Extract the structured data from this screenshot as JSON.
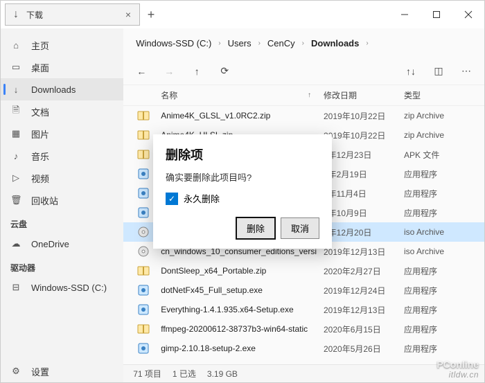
{
  "tab": {
    "label": "下载"
  },
  "sidebar": {
    "items": [
      {
        "label": "主页"
      },
      {
        "label": "桌面"
      },
      {
        "label": "Downloads"
      },
      {
        "label": "文档"
      },
      {
        "label": "图片"
      },
      {
        "label": "音乐"
      },
      {
        "label": "视频"
      },
      {
        "label": "回收站"
      }
    ],
    "cloud_header": "云盘",
    "cloud_items": [
      {
        "label": "OneDrive"
      }
    ],
    "drive_header": "驱动器",
    "drive_items": [
      {
        "label": "Windows-SSD (C:)"
      }
    ],
    "settings_label": "设置"
  },
  "breadcrumb": {
    "segs": [
      "Windows-SSD (C:)",
      "Users",
      "CenCy",
      "Downloads"
    ]
  },
  "columns": {
    "name": "名称",
    "date": "修改日期",
    "type": "类型"
  },
  "files": [
    {
      "name": "Anime4K_GLSL_v1.0RC2.zip",
      "date": "2019年10月22日",
      "type": "zip Archive",
      "icon": "zip"
    },
    {
      "name": "Anime4K_HLSL.zip",
      "date": "2019年10月22日",
      "type": "zip Archive",
      "icon": "zip"
    },
    {
      "name": "",
      "date": "9年12月23日",
      "type": "APK 文件",
      "icon": "zip"
    },
    {
      "name": "",
      "date": "0年2月19日",
      "type": "应用程序",
      "icon": "exe"
    },
    {
      "name": "",
      "date": "0年11月4日",
      "type": "应用程序",
      "icon": "exe"
    },
    {
      "name": "",
      "date": "9年10月9日",
      "type": "应用程序",
      "icon": "exe"
    },
    {
      "name": "",
      "date": "9年12月20日",
      "type": "iso Archive",
      "icon": "iso",
      "selected": true
    },
    {
      "name": "cn_windows_10_consumer_editions_versi",
      "date": "2019年12月13日",
      "type": "iso Archive",
      "icon": "iso"
    },
    {
      "name": "DontSleep_x64_Portable.zip",
      "date": "2020年2月27日",
      "type": "应用程序",
      "icon": "zip"
    },
    {
      "name": "dotNetFx45_Full_setup.exe",
      "date": "2019年12月24日",
      "type": "应用程序",
      "icon": "exe"
    },
    {
      "name": "Everything-1.4.1.935.x64-Setup.exe",
      "date": "2019年12月13日",
      "type": "应用程序",
      "icon": "exe"
    },
    {
      "name": "ffmpeg-20200612-38737b3-win64-static",
      "date": "2020年6月15日",
      "type": "应用程序",
      "icon": "zip"
    },
    {
      "name": "gimp-2.10.18-setup-2.exe",
      "date": "2020年5月26日",
      "type": "应用程序",
      "icon": "exe"
    }
  ],
  "status": {
    "count": "71 项目",
    "selected": "1 已选",
    "size": "3.19 GB"
  },
  "dialog": {
    "title": "删除项",
    "message": "确实要删除此项目吗?",
    "checkbox": "永久删除",
    "delete": "删除",
    "cancel": "取消"
  },
  "watermark1": "itldw.cn",
  "watermark2": "PConline"
}
